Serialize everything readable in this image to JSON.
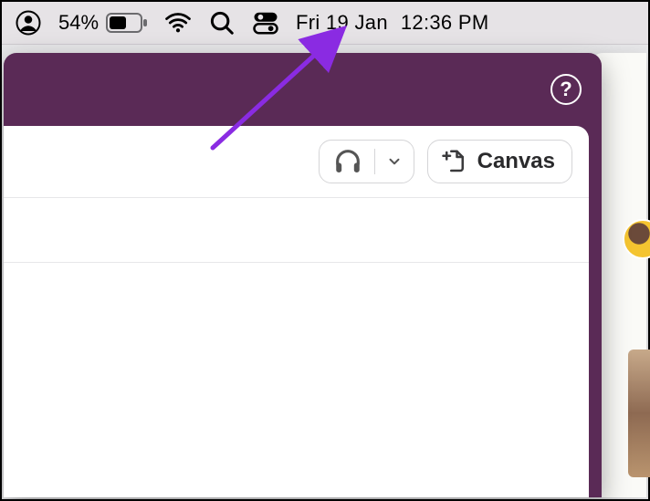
{
  "menubar": {
    "battery_percent": "54%",
    "date": "Fri 19 Jan",
    "time": "12:36 PM"
  },
  "slack": {
    "help_glyph": "?",
    "canvas_label": "Canvas"
  }
}
